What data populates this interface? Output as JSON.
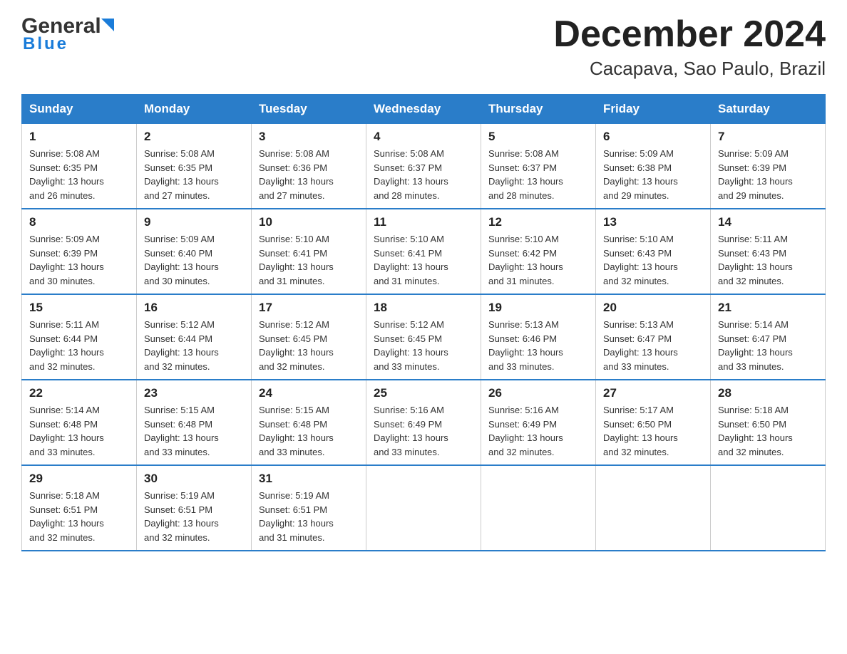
{
  "header": {
    "logo_general": "General",
    "logo_blue": "Blue",
    "title": "December 2024",
    "subtitle": "Cacapava, Sao Paulo, Brazil"
  },
  "weekdays": [
    "Sunday",
    "Monday",
    "Tuesday",
    "Wednesday",
    "Thursday",
    "Friday",
    "Saturday"
  ],
  "weeks": [
    [
      {
        "day": "1",
        "sunrise": "5:08 AM",
        "sunset": "6:35 PM",
        "daylight": "13 hours and 26 minutes."
      },
      {
        "day": "2",
        "sunrise": "5:08 AM",
        "sunset": "6:35 PM",
        "daylight": "13 hours and 27 minutes."
      },
      {
        "day": "3",
        "sunrise": "5:08 AM",
        "sunset": "6:36 PM",
        "daylight": "13 hours and 27 minutes."
      },
      {
        "day": "4",
        "sunrise": "5:08 AM",
        "sunset": "6:37 PM",
        "daylight": "13 hours and 28 minutes."
      },
      {
        "day": "5",
        "sunrise": "5:08 AM",
        "sunset": "6:37 PM",
        "daylight": "13 hours and 28 minutes."
      },
      {
        "day": "6",
        "sunrise": "5:09 AM",
        "sunset": "6:38 PM",
        "daylight": "13 hours and 29 minutes."
      },
      {
        "day": "7",
        "sunrise": "5:09 AM",
        "sunset": "6:39 PM",
        "daylight": "13 hours and 29 minutes."
      }
    ],
    [
      {
        "day": "8",
        "sunrise": "5:09 AM",
        "sunset": "6:39 PM",
        "daylight": "13 hours and 30 minutes."
      },
      {
        "day": "9",
        "sunrise": "5:09 AM",
        "sunset": "6:40 PM",
        "daylight": "13 hours and 30 minutes."
      },
      {
        "day": "10",
        "sunrise": "5:10 AM",
        "sunset": "6:41 PM",
        "daylight": "13 hours and 31 minutes."
      },
      {
        "day": "11",
        "sunrise": "5:10 AM",
        "sunset": "6:41 PM",
        "daylight": "13 hours and 31 minutes."
      },
      {
        "day": "12",
        "sunrise": "5:10 AM",
        "sunset": "6:42 PM",
        "daylight": "13 hours and 31 minutes."
      },
      {
        "day": "13",
        "sunrise": "5:10 AM",
        "sunset": "6:43 PM",
        "daylight": "13 hours and 32 minutes."
      },
      {
        "day": "14",
        "sunrise": "5:11 AM",
        "sunset": "6:43 PM",
        "daylight": "13 hours and 32 minutes."
      }
    ],
    [
      {
        "day": "15",
        "sunrise": "5:11 AM",
        "sunset": "6:44 PM",
        "daylight": "13 hours and 32 minutes."
      },
      {
        "day": "16",
        "sunrise": "5:12 AM",
        "sunset": "6:44 PM",
        "daylight": "13 hours and 32 minutes."
      },
      {
        "day": "17",
        "sunrise": "5:12 AM",
        "sunset": "6:45 PM",
        "daylight": "13 hours and 32 minutes."
      },
      {
        "day": "18",
        "sunrise": "5:12 AM",
        "sunset": "6:45 PM",
        "daylight": "13 hours and 33 minutes."
      },
      {
        "day": "19",
        "sunrise": "5:13 AM",
        "sunset": "6:46 PM",
        "daylight": "13 hours and 33 minutes."
      },
      {
        "day": "20",
        "sunrise": "5:13 AM",
        "sunset": "6:47 PM",
        "daylight": "13 hours and 33 minutes."
      },
      {
        "day": "21",
        "sunrise": "5:14 AM",
        "sunset": "6:47 PM",
        "daylight": "13 hours and 33 minutes."
      }
    ],
    [
      {
        "day": "22",
        "sunrise": "5:14 AM",
        "sunset": "6:48 PM",
        "daylight": "13 hours and 33 minutes."
      },
      {
        "day": "23",
        "sunrise": "5:15 AM",
        "sunset": "6:48 PM",
        "daylight": "13 hours and 33 minutes."
      },
      {
        "day": "24",
        "sunrise": "5:15 AM",
        "sunset": "6:48 PM",
        "daylight": "13 hours and 33 minutes."
      },
      {
        "day": "25",
        "sunrise": "5:16 AM",
        "sunset": "6:49 PM",
        "daylight": "13 hours and 33 minutes."
      },
      {
        "day": "26",
        "sunrise": "5:16 AM",
        "sunset": "6:49 PM",
        "daylight": "13 hours and 32 minutes."
      },
      {
        "day": "27",
        "sunrise": "5:17 AM",
        "sunset": "6:50 PM",
        "daylight": "13 hours and 32 minutes."
      },
      {
        "day": "28",
        "sunrise": "5:18 AM",
        "sunset": "6:50 PM",
        "daylight": "13 hours and 32 minutes."
      }
    ],
    [
      {
        "day": "29",
        "sunrise": "5:18 AM",
        "sunset": "6:51 PM",
        "daylight": "13 hours and 32 minutes."
      },
      {
        "day": "30",
        "sunrise": "5:19 AM",
        "sunset": "6:51 PM",
        "daylight": "13 hours and 32 minutes."
      },
      {
        "day": "31",
        "sunrise": "5:19 AM",
        "sunset": "6:51 PM",
        "daylight": "13 hours and 31 minutes."
      },
      null,
      null,
      null,
      null
    ]
  ],
  "labels": {
    "sunrise": "Sunrise:",
    "sunset": "Sunset:",
    "daylight": "Daylight:"
  }
}
